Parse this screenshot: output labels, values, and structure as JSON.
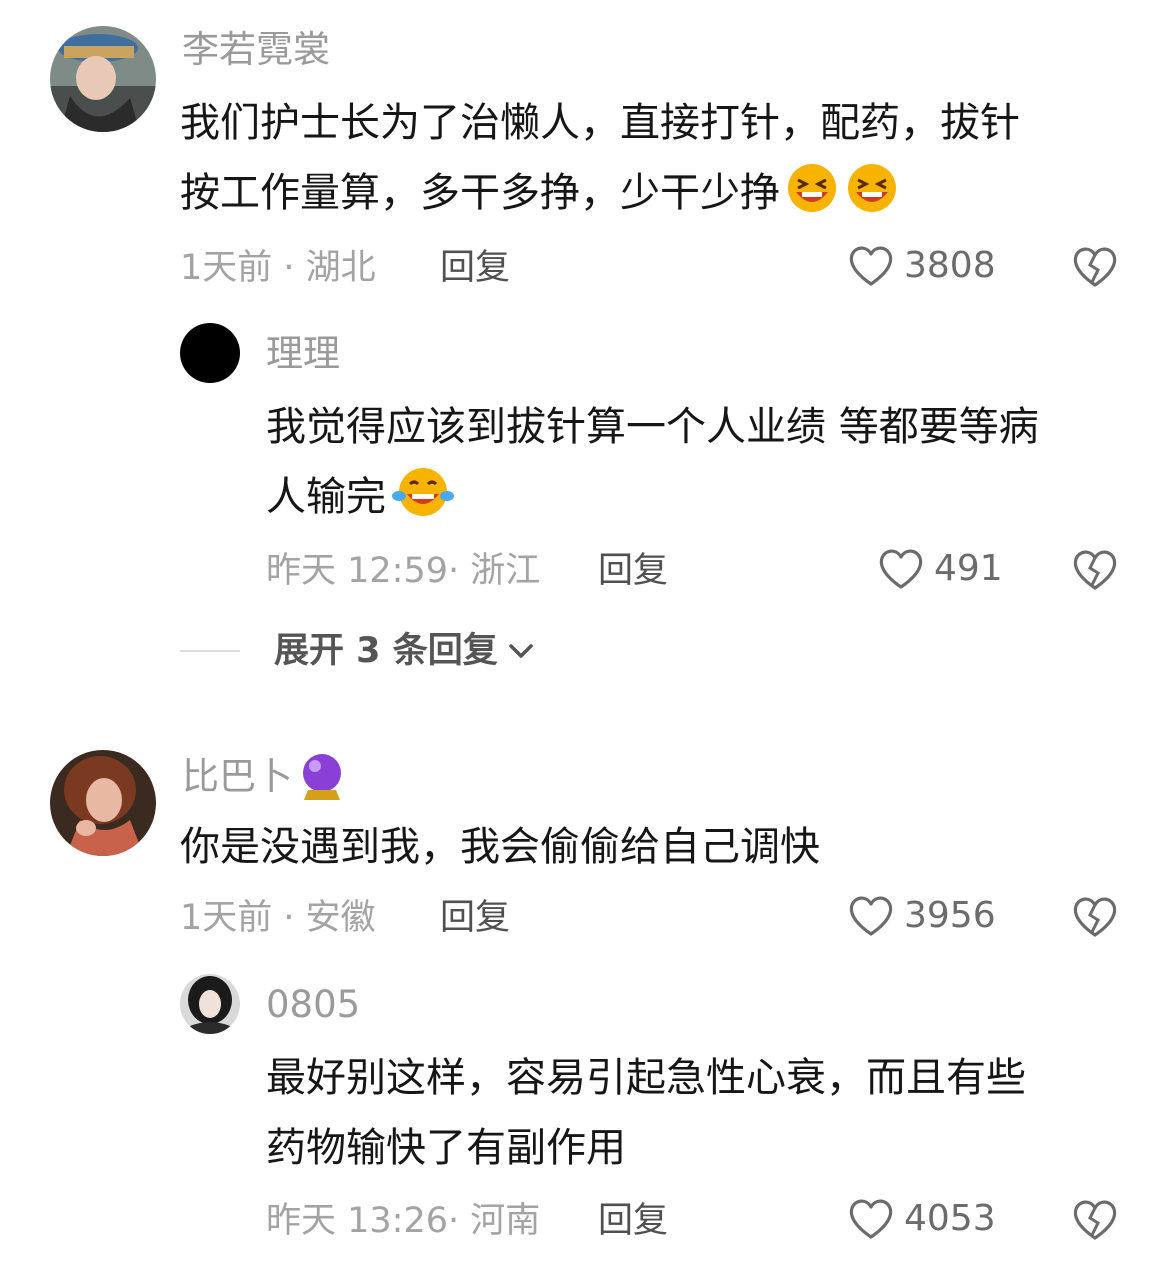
{
  "comments": [
    {
      "username": "李若霓裳",
      "line1": "我们护士长为了治懒人，直接打针，配药，拔针",
      "line2": "按工作量算，多干多挣，少干少挣",
      "time_location": "1天前 · 湖北",
      "reply_label": "回复",
      "likes": "3808",
      "emoji": "laughing-face"
    },
    {
      "username": "理理",
      "line1": "我觉得应该到拔针算一个人业绩 等都要等病",
      "line2": "人输完",
      "time_location": "昨天 12:59· 浙江",
      "reply_label": "回复",
      "likes": "491",
      "emoji": "tears-of-joy-face"
    },
    {
      "expand_label": "展开 3 条回复"
    },
    {
      "username": "比巴卜",
      "line1": "你是没遇到我，我会偷偷给自己调快",
      "time_location": "1天前 · 安徽",
      "reply_label": "回复",
      "likes": "3956",
      "badge_icon": "crystal-ball"
    },
    {
      "username": "0805",
      "line1": "最好别这样，容易引起急性心衰，而且有些",
      "line2": "药物输快了有副作用",
      "time_location": "昨天 13:26· 河南",
      "reply_label": "回复",
      "likes": "4053"
    }
  ],
  "colors": {
    "username": "#9a9a9a",
    "body": "#161616",
    "meta": "#a3a3a3",
    "icon": "#6b6b6b"
  }
}
